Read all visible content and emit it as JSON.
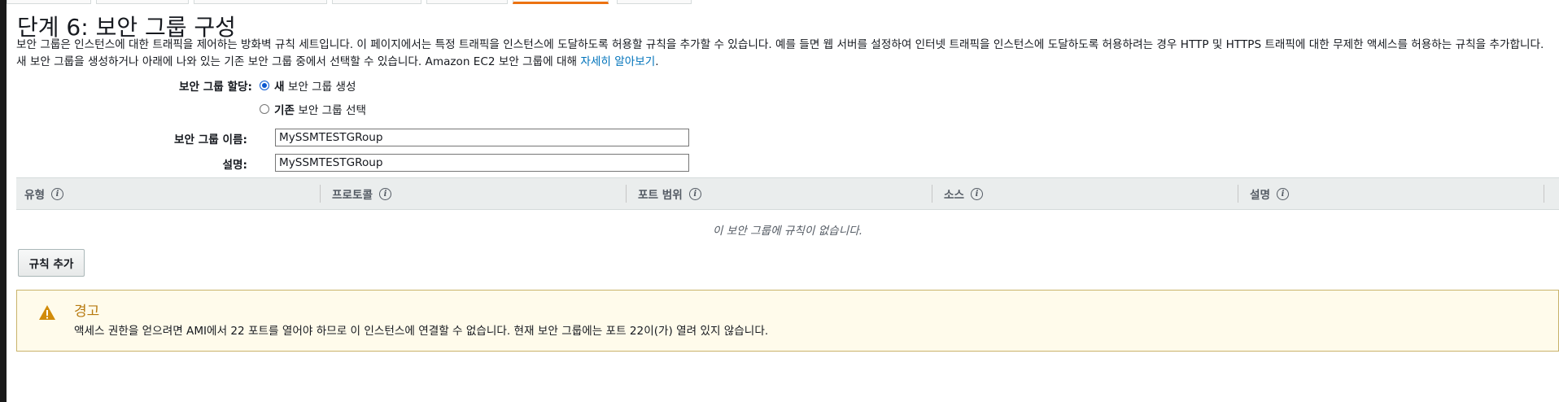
{
  "page": {
    "title": "단계 6: 보안 그룹 구성",
    "description": "보안 그룹은 인스턴스에 대한 트래픽을 제어하는 방화벽 규칙 세트입니다. 이 페이지에서는 특정 트래픽을 인스턴스에 도달하도록 허용할 규칙을 추가할 수 있습니다. 예를 들면 웹 서버를 설정하여 인터넷 트래픽을 인스턴스에 도달하도록 허용하려는 경우 HTTP 및 HTTPS 트래픽에 대한 무제한 액세스를 허용하는 규칙을 추가합니다. 새 보안 그룹을 생성하거나 아래에 나와 있는 기존 보안 그룹 중에서 선택할 수 있습니다. Amazon EC2 보안 그룹에 대해",
    "learn_more": "자세히 알아보기",
    "learn_more_suffix": "."
  },
  "assignment": {
    "label": "보안 그룹 할당:",
    "option_new_bold": "새",
    "option_new_rest": " 보안 그룹 생성",
    "option_existing_bold": "기존",
    "option_existing_rest": " 보안 그룹 선택",
    "selected": "new"
  },
  "fields": {
    "name_label": "보안 그룹 이름:",
    "name_value": "MySSMTESTGRoup",
    "desc_label": "설명:",
    "desc_value": "MySSMTESTGRoup"
  },
  "table": {
    "columns": [
      "유형",
      "프로토콜",
      "포트 범위",
      "소스",
      "설명"
    ],
    "empty_message": "이 보안 그룹에 규칙이 없습니다."
  },
  "add_rule_label": "규칙 추가",
  "warning": {
    "title": "경고",
    "message": "액세스 권한을 얻으려면 AMI에서 22 포트를 열어야 하므로 이 인스턴스에 연결할 수 없습니다. 현재 보안 그룹에는 포트 22이(가) 열려 있지 않습니다."
  },
  "colors": {
    "accent": "#ec7211",
    "link": "#0073bb",
    "warning_border": "#c9b36b",
    "warning_bg": "#fffbeb",
    "warning_icon": "#d18b0a",
    "table_header_bg": "#eaeded"
  }
}
